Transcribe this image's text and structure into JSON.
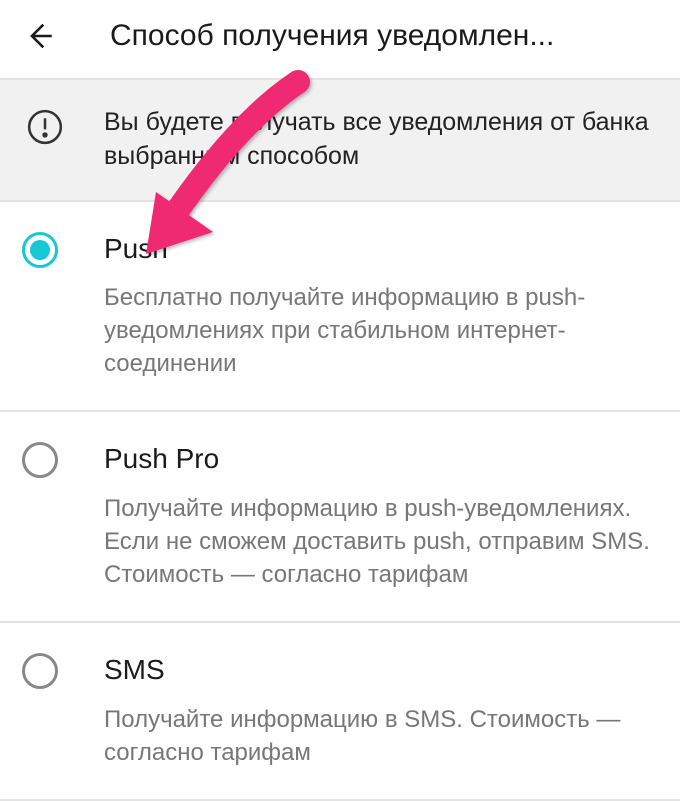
{
  "header": {
    "title": "Способ получения уведомлен..."
  },
  "info": {
    "text": "Вы будете получать все уведомления от банка выбранным способом"
  },
  "options": [
    {
      "title": "Push",
      "desc": "Бесплатно получайте информацию в push-уведомлениях при стабильном интернет-соединении",
      "selected": true
    },
    {
      "title": "Push Pro",
      "desc": "Получайте информацию в push-уведомлениях. Если не сможем доставить push, отправим SMS. Стоимость — согласно тарифам",
      "selected": false
    },
    {
      "title": "SMS",
      "desc": "Получайте информацию в SMS. Стоимость — согласно тарифам",
      "selected": false
    }
  ]
}
